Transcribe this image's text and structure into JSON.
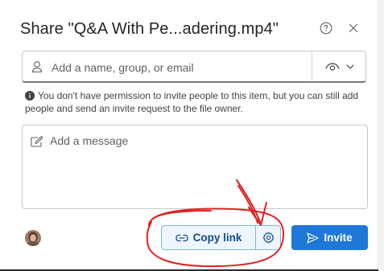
{
  "dialog": {
    "title": "Share \"Q&A With Pe...adering.mp4\"",
    "help_icon": "question-circle-icon",
    "close_icon": "close-icon"
  },
  "people": {
    "placeholder": "Add a name, group, or email",
    "icon": "person-icon",
    "permission_icon": "eye-icon",
    "dropdown_icon": "chevron-down-icon"
  },
  "notice": {
    "text": "You don't have permission to invite people to this item, but you can still add people and send an invite request to the file owner.",
    "icon": "info-icon"
  },
  "message": {
    "placeholder": "Add a message",
    "icon": "edit-icon"
  },
  "footer": {
    "copy_link_label": "Copy link",
    "copy_link_icon": "link-icon",
    "settings_icon": "gear-icon",
    "invite_label": "Invite",
    "invite_icon": "send-icon"
  },
  "colors": {
    "accent": "#1e78d8",
    "annotation": "#e02020"
  }
}
